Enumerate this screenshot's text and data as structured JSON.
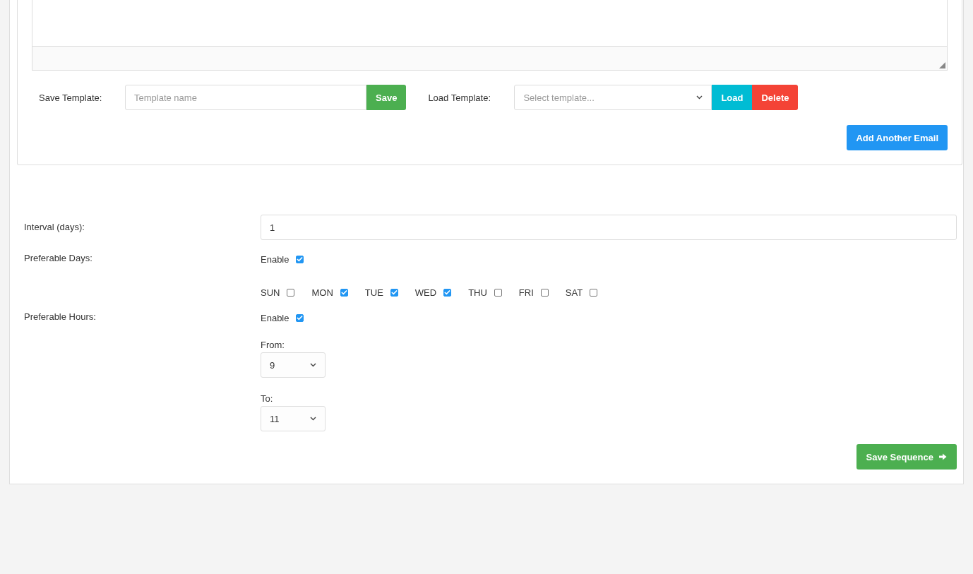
{
  "email_editor": {
    "save_template": {
      "label": "Save Template:",
      "placeholder": "Template name",
      "button": "Save"
    },
    "load_template": {
      "label": "Load Template:",
      "placeholder": "Select template...",
      "load_button": "Load",
      "delete_button": "Delete"
    },
    "add_button": "Add Another Email"
  },
  "settings": {
    "interval": {
      "label": "Interval (days):",
      "value": "1"
    },
    "preferable_days": {
      "label": "Preferable Days:",
      "enable_label": "Enable",
      "enabled": true,
      "days": [
        {
          "label": "SUN",
          "checked": false
        },
        {
          "label": "MON",
          "checked": true
        },
        {
          "label": "TUE",
          "checked": true
        },
        {
          "label": "WED",
          "checked": true
        },
        {
          "label": "THU",
          "checked": false
        },
        {
          "label": "FRI",
          "checked": false
        },
        {
          "label": "SAT",
          "checked": false
        }
      ]
    },
    "preferable_hours": {
      "label": "Preferable Hours:",
      "enable_label": "Enable",
      "enabled": true,
      "from": {
        "label": "From:",
        "value": "9"
      },
      "to": {
        "label": "To:",
        "value": "11"
      }
    },
    "save_button": "Save Sequence"
  }
}
